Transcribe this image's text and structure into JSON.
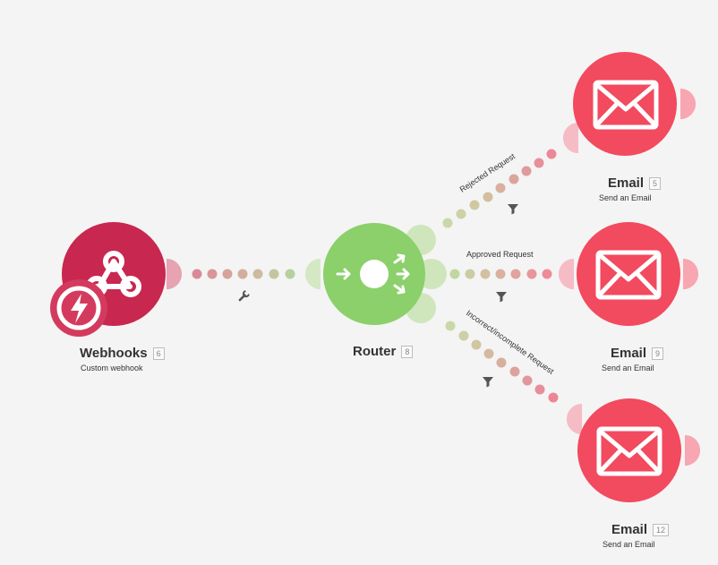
{
  "nodes": {
    "webhooks": {
      "title": "Webhooks",
      "id": "6",
      "subtitle": "Custom webhook",
      "color": "#c8274f",
      "accent": "#d43a5e"
    },
    "router": {
      "title": "Router",
      "id": "8",
      "color": "#8bd06a"
    },
    "email_rejected": {
      "title": "Email",
      "id": "5",
      "subtitle": "Send an Email",
      "color": "#f24a5e"
    },
    "email_approved": {
      "title": "Email",
      "id": "9",
      "subtitle": "Send an Email",
      "color": "#f24a5e"
    },
    "email_incorrect": {
      "title": "Email",
      "id": "12",
      "subtitle": "Send an Email",
      "color": "#f24a5e"
    }
  },
  "routes": {
    "rejected": "Rejected Request",
    "approved": "Approved Request",
    "incorrect": "Incorrect/incomplete Request"
  },
  "icons": {
    "webhook": "webhook-icon",
    "instant": "lightning-icon",
    "router": "router-icon",
    "email": "envelope-icon",
    "filter": "filter-icon",
    "settings": "wrench-icon"
  }
}
